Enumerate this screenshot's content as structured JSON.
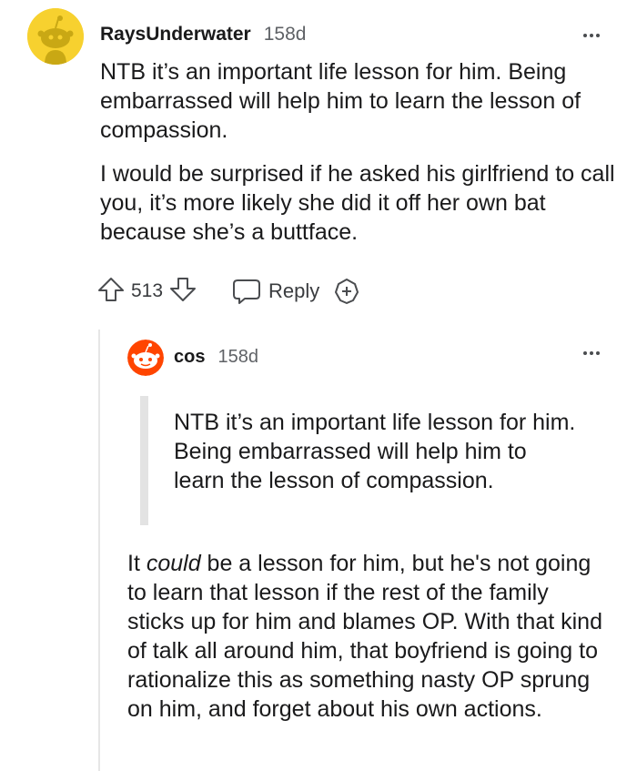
{
  "comment": {
    "author": "RaysUnderwater",
    "age": "158d",
    "paragraphs": [
      "NTB it’s an important life lesson for him. Being embarrassed will help him to learn the lesson of compassion.",
      "I would be surprised if he asked his girlfriend to call you, it’s more likely she did it off her own bat because she’s a buttface."
    ],
    "score": "513",
    "reply_label": "Reply",
    "avatar_color": "#f7d12f"
  },
  "reply": {
    "author": "cos",
    "age": "158d",
    "quote": "NTB it’s an important life lesson for him. Being embarrassed will help him to learn the lesson of compassion.",
    "body_before_emphasis": "It ",
    "body_emphasis": "could",
    "body_after_emphasis": " be a lesson for him, but he's not going to learn that lesson if the rest of the family sticks up for him and blames OP. With that kind of talk all around him, that boyfriend is going to rationalize this as something nasty OP sprung on him, and forget about his own actions.",
    "avatar_color": "#ff4500"
  },
  "icons": {
    "upvote": "arrow-up-outline-icon",
    "downvote": "arrow-down-outline-icon",
    "reply": "speech-bubble-icon",
    "award": "award-plus-icon",
    "more": "three-dots-icon"
  }
}
